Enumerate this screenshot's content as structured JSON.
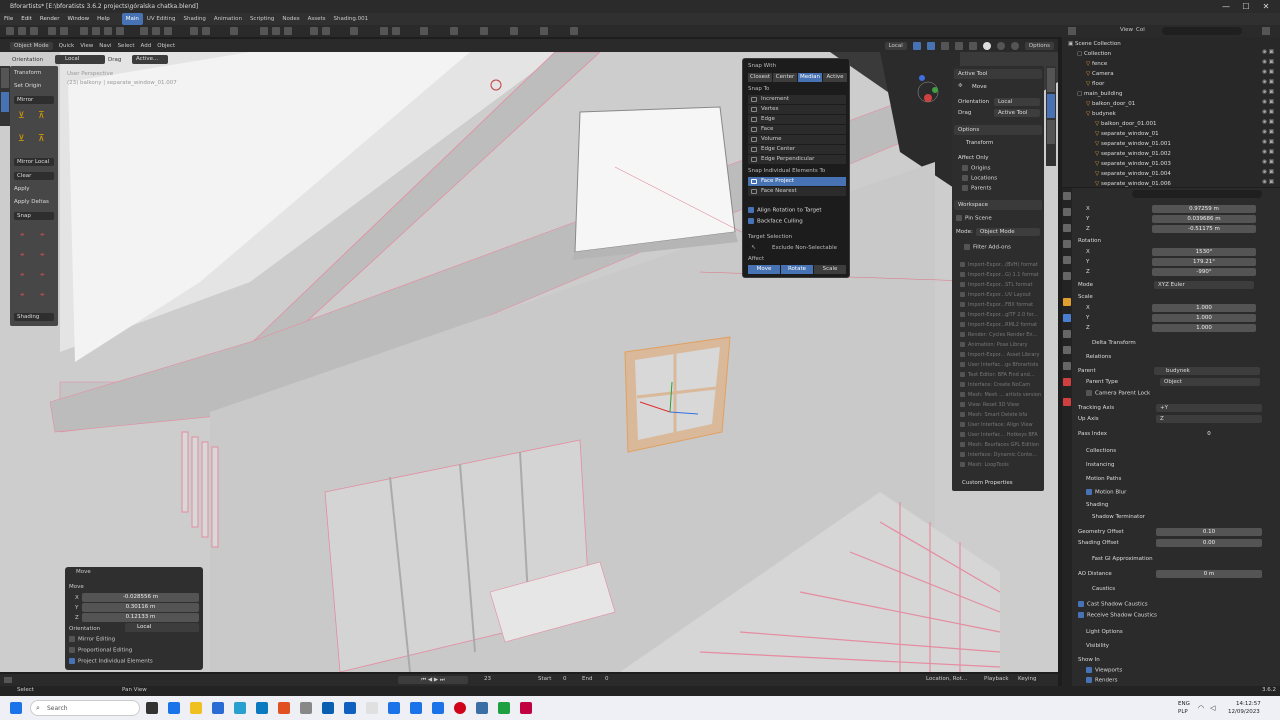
{
  "title_bar": {
    "title": "Bforartists* [E:\\bforatists 3.6.2 projects\\góralska chatka.blend]",
    "controls": [
      "—",
      "☐",
      "✕"
    ]
  },
  "menu": {
    "items": [
      "File",
      "Edit",
      "Render",
      "Window",
      "Help"
    ],
    "workspaces": [
      "Main",
      "UV Editing",
      "Shading",
      "Animation",
      "Scripting",
      "Nodes",
      "Assets",
      "Shading.001"
    ],
    "active_workspace": "Main"
  },
  "viewport_header": {
    "mode": "Object Mode",
    "items": [
      "Quick",
      "View",
      "Navi",
      "Select",
      "Add",
      "Object"
    ],
    "orientation_label": "Local",
    "options_label": "Options"
  },
  "viewport": {
    "info_line1": "User Perspective",
    "info_line2": "(23) balkony | separate_window_01.007"
  },
  "tool_settings": {
    "orientation_label": "Orientation",
    "orientation_value": "Local",
    "drag_label": "Drag",
    "drag_value": "Active..."
  },
  "tools_panel": {
    "items": [
      "Transform",
      "Set Origin",
      "Mirror",
      "Mirror Local",
      "Clear",
      "Apply",
      "Apply Deltas",
      "Snap",
      "Shading"
    ]
  },
  "move_panel": {
    "title": "Move",
    "section": "Move",
    "x_label": "X",
    "x_value": "-0.028556 m",
    "y_label": "Y",
    "y_value": "0.30116 m",
    "z_label": "Z",
    "z_value": "0.12133 m",
    "orientation_label": "Orientation",
    "orientation_value": "Local",
    "mirror_editing": "Mirror Editing",
    "proportional_editing": "Proportional Editing",
    "project_individual": "Project Individual Elements"
  },
  "snap_popup": {
    "snap_with_label": "Snap With",
    "snap_with": [
      "Closest",
      "Center",
      "Median",
      "Active"
    ],
    "snap_with_active": "Median",
    "snap_to_label": "Snap To",
    "snap_to": [
      "Increment",
      "Vertex",
      "Edge",
      "Face",
      "Volume",
      "Edge Center",
      "Edge Perpendicular"
    ],
    "individual_label": "Snap Individual Elements To",
    "individual": [
      "Face Project",
      "Face Nearest"
    ],
    "individual_active": "Face Project",
    "align_rotation": "Align Rotation to Target",
    "backface_culling": "Backface Culling",
    "target_selection_label": "Target Selection",
    "exclude_non_selectable": "Exclude Non-Selectable",
    "affect_label": "Affect",
    "affect": [
      "Move",
      "Rotate",
      "Scale"
    ]
  },
  "n_panel": {
    "active_tool_label": "Active Tool",
    "tool_name": "Move",
    "orientation_label": "Orientation",
    "orientation_value": "Local",
    "drag_label": "Drag",
    "drag_value": "Active Tool",
    "options_label": "Options",
    "transform_label": "Transform",
    "affect_only_label": "Affect Only",
    "affect_only": [
      "Origins",
      "Locations",
      "Parents"
    ],
    "workspace_label": "Workspace",
    "pin_scene": "Pin Scene",
    "mode_label": "Mode:",
    "mode_value": "Object Mode",
    "filter_addons": "Filter Add-ons",
    "addons": [
      "Import-Expor...(BVH) format",
      "Import-Expor...G) 1.1 format",
      "Import-Expor...STL format",
      "Import-Expor...UV Layout",
      "Import-Expor...FBX format",
      "Import-Expor...glTF 2.0 for...",
      "Import-Expor...RML2 format",
      "Render: Cycles Render En...",
      "Animation: Pose Library",
      "Import-Expor... Asset Library",
      "User Interfac...gs Bforartists",
      "Text Editor: BFA Find and...",
      "Interface: Create NoCam",
      "Mesh: Mesh ... artists version",
      "View: Reset 3D View",
      "Mesh: Smart Delete bfa",
      "User Interface: Align View",
      "User Interfac... Hotkeys BFA",
      "Mesh: Bsurfaces GPL Edition",
      "Interface: Dynamic Conte...",
      "Mesh: LoopTools"
    ],
    "custom_properties": "Custom Properties"
  },
  "outliner": {
    "rows": [
      {
        "name": "Scene Collection",
        "depth": 0
      },
      {
        "name": "Collection",
        "depth": 1
      },
      {
        "name": "fence",
        "depth": 2
      },
      {
        "name": "Camera",
        "depth": 2
      },
      {
        "name": "floor",
        "depth": 2
      },
      {
        "name": "main_building",
        "depth": 1
      },
      {
        "name": "balkon_door_01",
        "depth": 2
      },
      {
        "name": "budynek",
        "depth": 2
      },
      {
        "name": "balkon_door_01.001",
        "depth": 3
      },
      {
        "name": "separate_window_01",
        "depth": 3
      },
      {
        "name": "separate_window_01.001",
        "depth": 3
      },
      {
        "name": "separate_window_01.002",
        "depth": 3
      },
      {
        "name": "separate_window_01.003",
        "depth": 3
      },
      {
        "name": "separate_window_01.004",
        "depth": 3
      },
      {
        "name": "separate_window_01.006",
        "depth": 3
      }
    ]
  },
  "properties": {
    "location": {
      "x": "0.97259 m",
      "y": "0.039686 m",
      "z": "-0.51175 m"
    },
    "rotation_label": "Rotation",
    "rotation": {
      "x": "1530°",
      "y": "179.21°",
      "z": "-990°"
    },
    "mode_label": "Mode",
    "mode_value": "XYZ Euler",
    "scale_label": "Scale",
    "scale": {
      "x": "1.000",
      "y": "1.000",
      "z": "1.000"
    },
    "delta_transform": "Delta Transform",
    "relations": "Relations",
    "parent_label": "Parent",
    "parent_value": "budynek",
    "parent_type_label": "Parent Type",
    "parent_type_value": "Object",
    "camera_parent_lock": "Camera Parent Lock",
    "tracking_axis_label": "Tracking Axis",
    "tracking_axis_value": "+Y",
    "up_axis_label": "Up Axis",
    "up_axis_value": "Z",
    "pass_index_label": "Pass Index",
    "pass_index_value": "0",
    "collections": "Collections",
    "instancing": "Instancing",
    "motion_paths": "Motion Paths",
    "motion_blur": "Motion Blur",
    "shading": "Shading",
    "shadow_terminator": "Shadow Terminator",
    "geometry_offset_label": "Geometry Offset",
    "geometry_offset_value": "0.10",
    "shading_offset_label": "Shading Offset",
    "shading_offset_value": "0.00",
    "fast_gi": "Fast GI Approximation",
    "ao_distance_label": "AO Distance",
    "ao_distance_value": "0 m",
    "caustics": "Caustics",
    "cast_shadow_caustics": "Cast Shadow Caustics",
    "receive_shadow_caustics": "Receive Shadow Caustics",
    "light_options": "Light Options",
    "visibility": "Visibility",
    "show_in": "Show In",
    "viewports": "Viewports",
    "renders": "Renders"
  },
  "timeline": {
    "frame": "23",
    "start_label": "Start",
    "start_value": "0",
    "end_label": "End",
    "end_value": "0",
    "location_rot": "Location, Rot...",
    "playback": "Playback",
    "keying": "Keying"
  },
  "status_bar": {
    "select": "Select",
    "pan_view": "Pan View",
    "version": "3.6.2"
  },
  "taskbar": {
    "search_placeholder": "Search",
    "lang": "ENG",
    "lang2": "PLP",
    "time": "14:12:57",
    "date": "12/09/2023"
  }
}
